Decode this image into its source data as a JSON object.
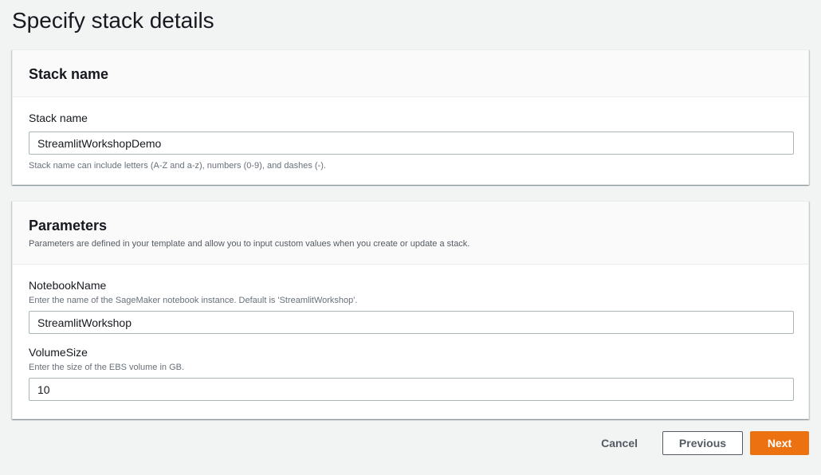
{
  "page": {
    "title": "Specify stack details"
  },
  "stack_panel": {
    "heading": "Stack name",
    "field_label": "Stack name",
    "input_value": "StreamlitWorkshopDemo",
    "constraint_text": "Stack name can include letters (A-Z and a-z), numbers (0-9), and dashes (-)."
  },
  "params_panel": {
    "heading": "Parameters",
    "description": "Parameters are defined in your template and allow you to input custom values when you create or update a stack.",
    "params": [
      {
        "label": "NotebookName",
        "description": "Enter the name of the SageMaker notebook instance. Default is 'StreamlitWorkshop'.",
        "value": "StreamlitWorkshop"
      },
      {
        "label": "VolumeSize",
        "description": "Enter the size of the EBS volume in GB.",
        "value": "10"
      }
    ]
  },
  "footer": {
    "cancel_label": "Cancel",
    "previous_label": "Previous",
    "next_label": "Next"
  },
  "colors": {
    "primary": "#ec7211",
    "background": "#f2f3f3",
    "text": "#16191f",
    "muted": "#545b64"
  }
}
